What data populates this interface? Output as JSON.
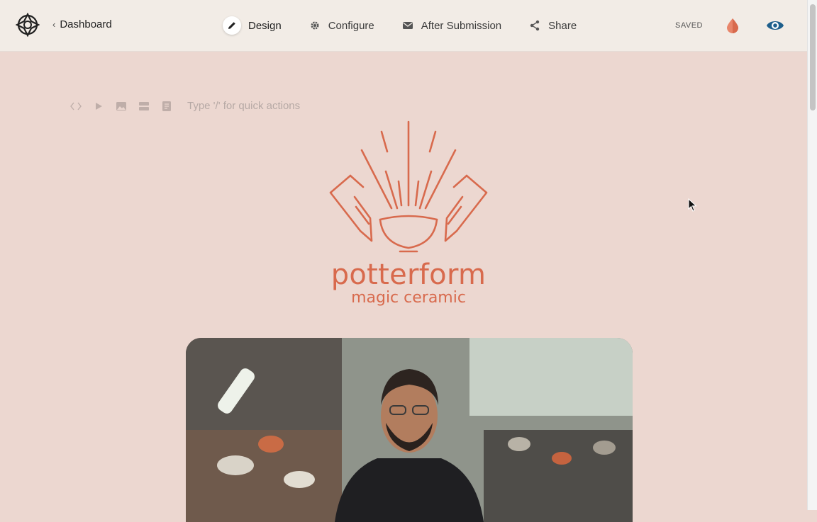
{
  "header": {
    "back_label": "Dashboard",
    "tabs": [
      {
        "label": "Design",
        "icon": "pencil-icon",
        "active": true
      },
      {
        "label": "Configure",
        "icon": "gear-icon",
        "active": false
      },
      {
        "label": "After Submission",
        "icon": "envelope-icon",
        "active": false
      },
      {
        "label": "Share",
        "icon": "share-icon",
        "active": false
      }
    ],
    "status": "SAVED",
    "colors": {
      "accent": "#d86a4d",
      "preview": "#1e5f8c",
      "bar_bg": "#f2ece6",
      "page_bg": "#ecd7d0"
    }
  },
  "editor": {
    "quick_actions_placeholder": "Type '/' for quick actions",
    "toolbar_icons": [
      "code-icon",
      "play-icon",
      "image-icon",
      "divider-icon",
      "document-icon"
    ]
  },
  "brand": {
    "name": "potterform",
    "tagline": "magic ceramic"
  }
}
